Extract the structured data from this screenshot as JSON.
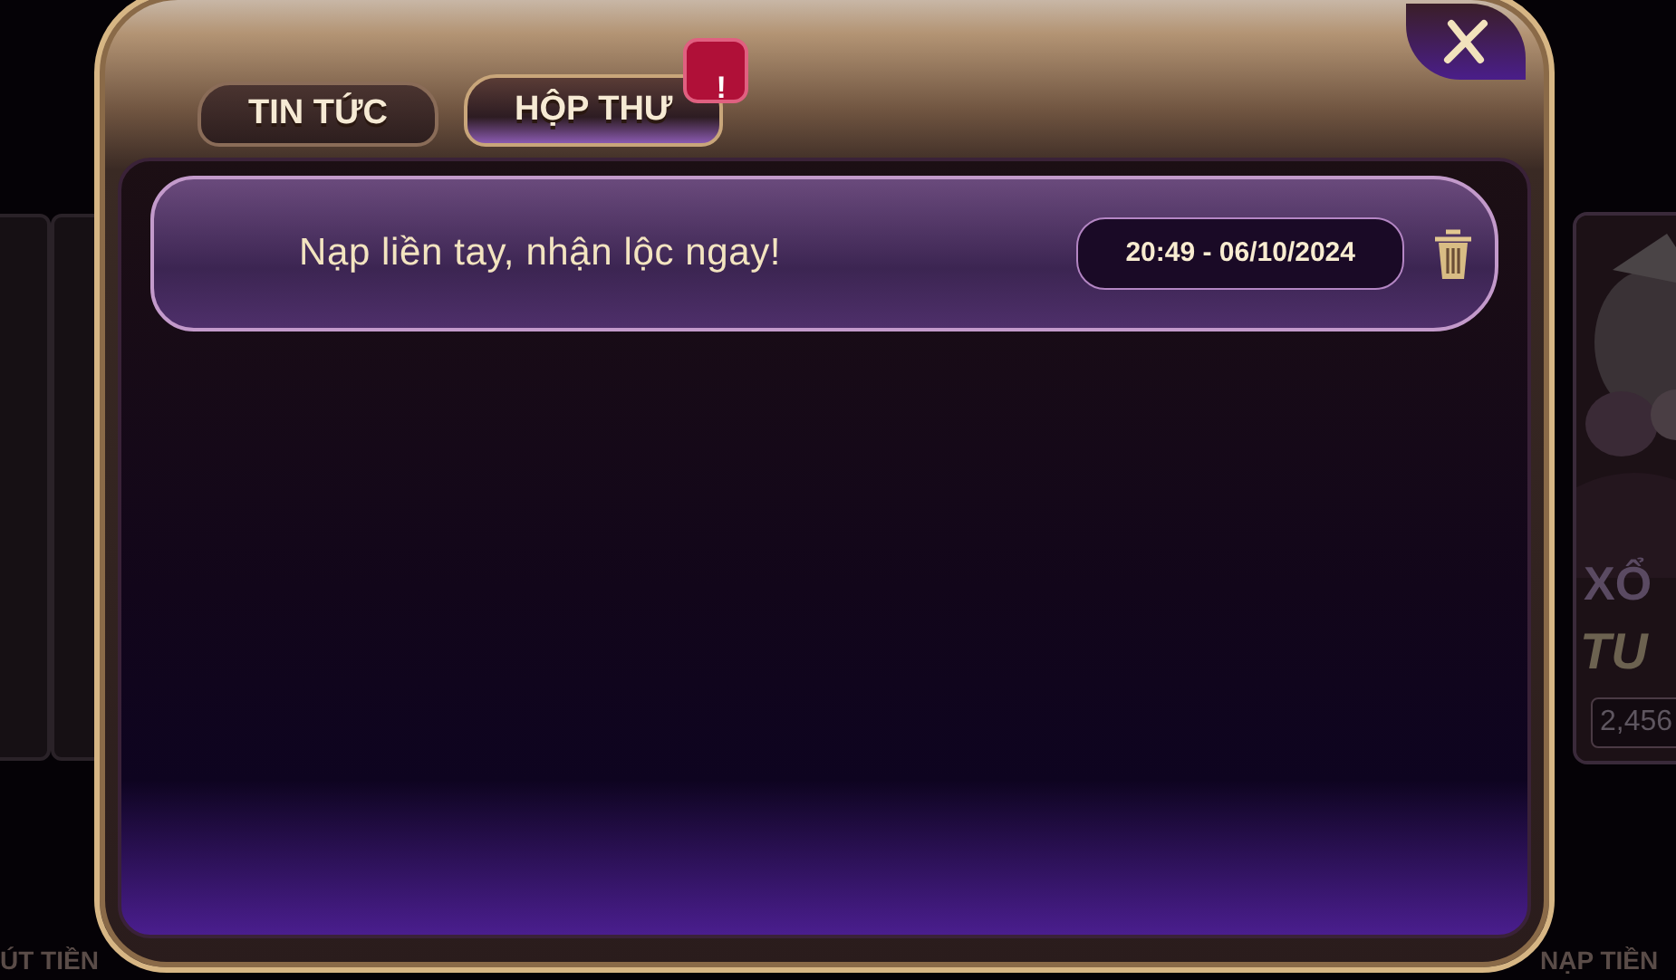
{
  "background": {
    "game_card": {
      "title": "XỔ",
      "subtitle": "TU",
      "jackpot": "2,456"
    },
    "bottom_buttons": [
      "ÚT TIỀN",
      "NẠP TIỀN"
    ]
  },
  "dialog": {
    "tabs": [
      {
        "label": "TIN TỨC",
        "selected": false
      },
      {
        "label": "HỘP THƯ",
        "selected": true,
        "badge": "!"
      }
    ],
    "messages": [
      {
        "title": "Nạp liền tay, nhận lộc ngay!",
        "time": "20:49 - 06/10/2024"
      }
    ]
  }
}
